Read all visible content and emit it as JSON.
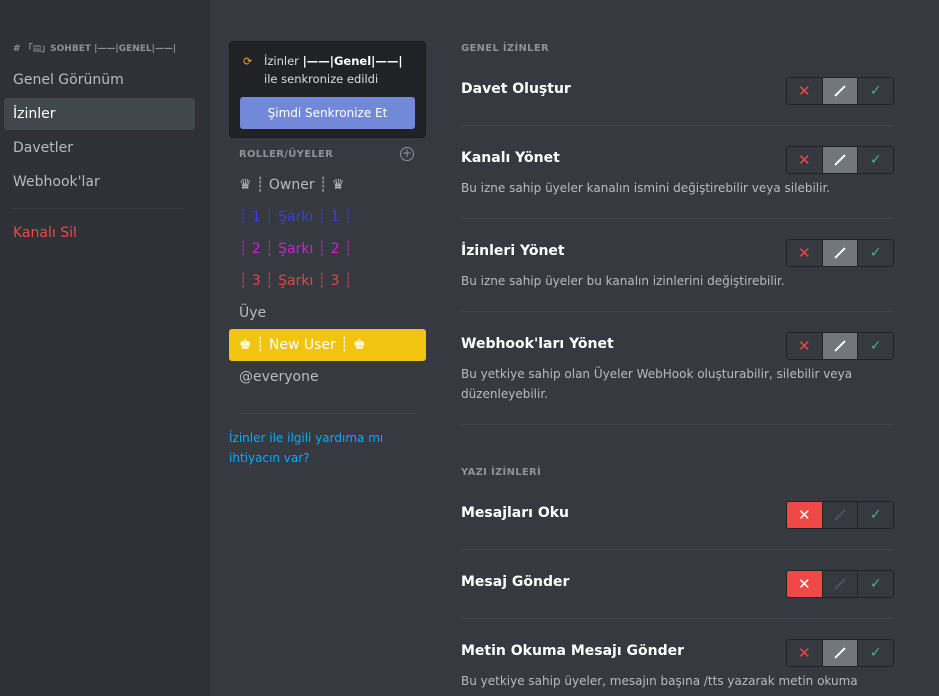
{
  "sidebar": {
    "channel": "# 「▤」SOHBET |——|GENEL|——|",
    "items": [
      {
        "label": "Genel Görünüm"
      },
      {
        "label": "İzinler"
      },
      {
        "label": "Davetler"
      },
      {
        "label": "Webhook'lar"
      }
    ],
    "delete_label": "Kanalı Sil"
  },
  "sync": {
    "prefix": "İzinler",
    "channel": "|——|Genel|——|",
    "line2": "ile senkronize edildi",
    "button": "Şimdi Senkronize Et"
  },
  "roles": {
    "header": "ROLLER/ÜYELER",
    "items": [
      {
        "label": "♛ ┊ Owner ┊ ♛",
        "color": "#b9bbbe"
      },
      {
        "label": "┊ 1 ┊ Şarkı ┊ 1 ┊",
        "color": "#3b3ee0"
      },
      {
        "label": "┊ 2 ┊ Şarkı ┊ 2 ┊",
        "color": "#d11fd1"
      },
      {
        "label": "┊ 3 ┊ Şarkı ┊ 3 ┊",
        "color": "#e8414a"
      },
      {
        "label": "Üye",
        "color": "#b9bbbe"
      },
      {
        "label": "♚ ┊ New User ┊ ♚",
        "color": "#ffffff"
      },
      {
        "label": "@everyone",
        "color": "#b9bbbe"
      }
    ],
    "help": "İzinler ile ilgili yardıma mı ihtiyacın var?"
  },
  "permissions": {
    "general_header": "GENEL İZİNLER",
    "text_header": "YAZI İZİNLERİ",
    "items": [
      {
        "title": "Davet Oluştur",
        "desc": "",
        "state": "pass"
      },
      {
        "title": "Kanalı Yönet",
        "desc": "Bu izne sahip üyeler kanalın ismini değiştirebilir veya silebilir.",
        "state": "pass"
      },
      {
        "title": "İzinleri Yönet",
        "desc": "Bu izne sahip üyeler bu kanalın izinlerini değiştirebilir.",
        "state": "pass"
      },
      {
        "title": "Webhook'ları Yönet",
        "desc": "Bu yetkiye sahip olan Üyeler WebHook oluşturabilir, silebilir veya düzenleyebilir.",
        "state": "pass"
      },
      {
        "title": "Mesajları Oku",
        "desc": "",
        "state": "deny"
      },
      {
        "title": "Mesaj Gönder",
        "desc": "",
        "state": "deny"
      },
      {
        "title": "Metin Okuma Mesajı Gönder",
        "desc": "Bu yetkiye sahip üyeler, mesajın başına /tts yazarak metin okuma",
        "state": "pass"
      }
    ]
  },
  "icons": {
    "deny": "✕",
    "allow": "✓",
    "add": "+",
    "sync": "⟳"
  },
  "colors": {
    "accent": "#7289da",
    "danger": "#f04747",
    "success": "#43b581",
    "selected_role": "#f1c40f",
    "link": "#00b0f4"
  }
}
